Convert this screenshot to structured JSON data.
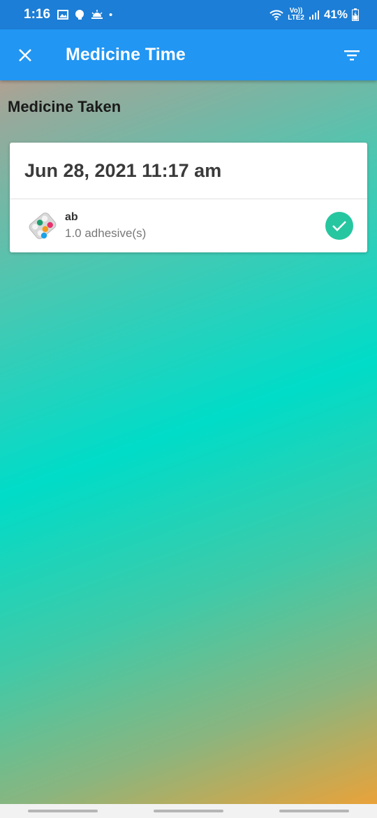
{
  "status": {
    "time": "1:16",
    "network": "LTE2",
    "volte": "Vo))",
    "battery": "41%"
  },
  "app_bar": {
    "title": "Medicine Time",
    "close_icon": "close-icon",
    "filter_icon": "filter-icon"
  },
  "section": {
    "title": "Medicine Taken"
  },
  "entry": {
    "datetime": "Jun 28, 2021 11:17 am",
    "medicines": [
      {
        "name": "ab",
        "dose": "1.0 adhesive(s)",
        "status_icon": "check-icon"
      }
    ]
  },
  "colors": {
    "status_bar": "#1c7ed6",
    "app_bar": "#2196f3",
    "check": "#26c6a0"
  }
}
